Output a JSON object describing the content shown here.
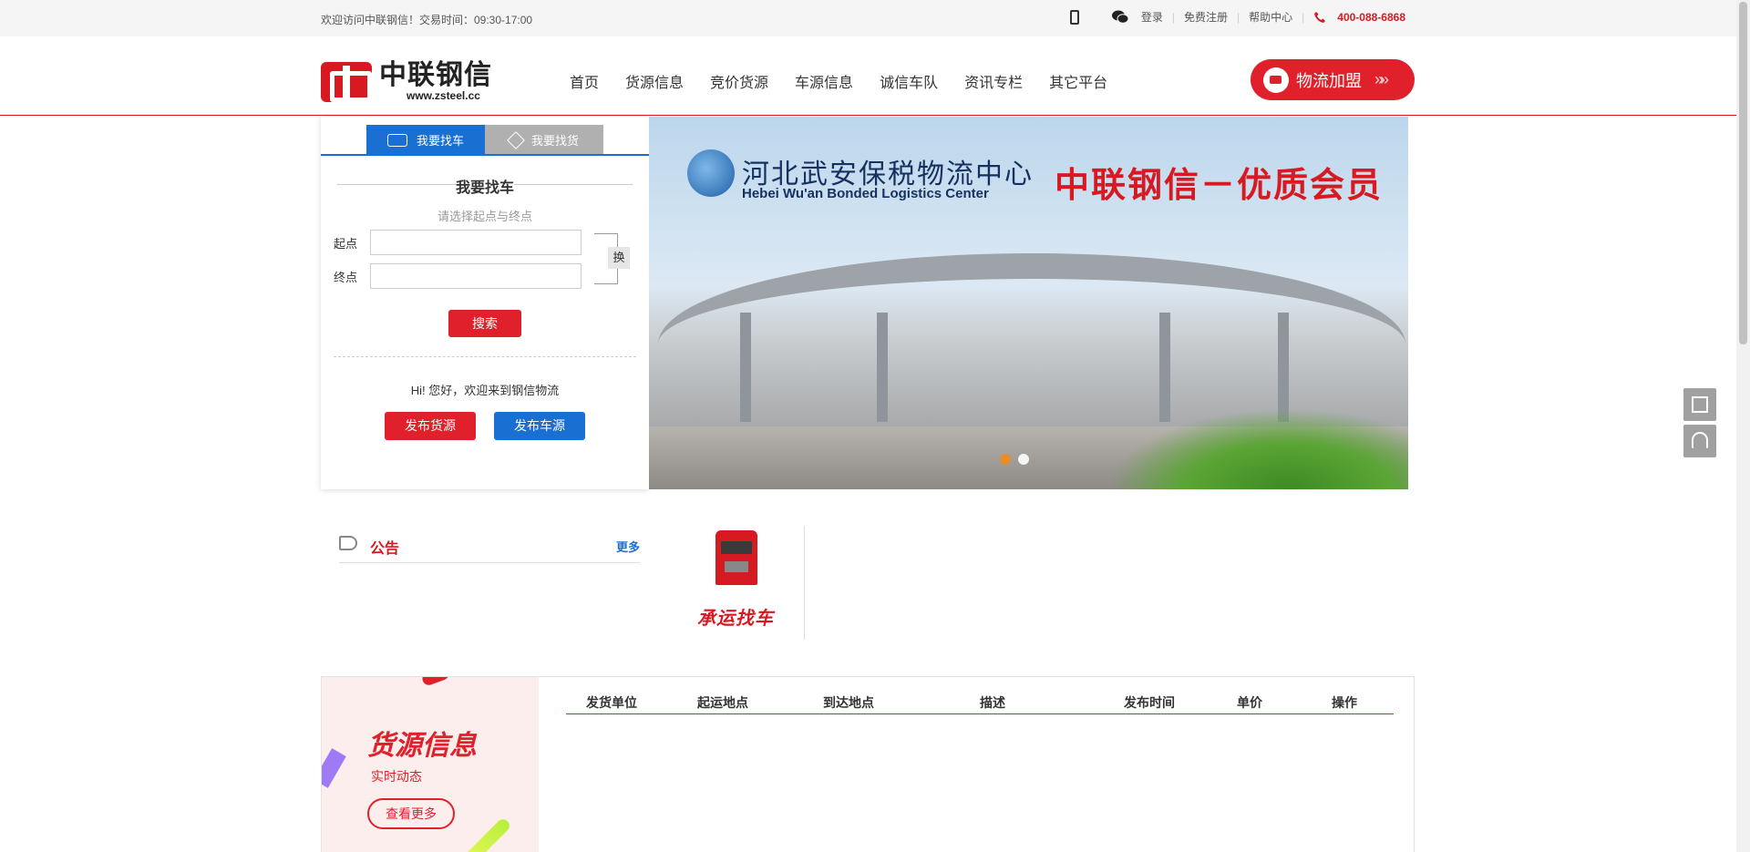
{
  "topbar": {
    "welcome": "欢迎访问中联钢信！交易时间：09:30-17:00",
    "login": "登录",
    "register": "免费注册",
    "help": "帮助中心",
    "tel": "400-088-6868"
  },
  "logo": {
    "cn": "中联钢信",
    "en": "www.zsteel.cc"
  },
  "nav": [
    "首页",
    "货源信息",
    "竞价货源",
    "车源信息",
    "诚信车队",
    "资讯专栏",
    "其它平台"
  ],
  "join": {
    "label": "物流加盟",
    "arrows": "»»"
  },
  "panel": {
    "tab_car": "我要找车",
    "tab_goods": "我要找货",
    "title": "我要找车",
    "subtitle": "请选择起点与终点",
    "start_label": "起点",
    "end_label": "终点",
    "swap": "换",
    "search": "搜索",
    "hi": "Hi! 您好，欢迎来到钢信物流",
    "publish_goods": "发布货源",
    "publish_car": "发布车源"
  },
  "banner": {
    "cn_name": "河北武安保税物流中心",
    "en_name": "Hebei Wu'an Bonded Logistics Center",
    "slogan": "中联钢信－优质会员"
  },
  "notice": {
    "title": "公告",
    "more": "更多"
  },
  "truck": {
    "label": "承运找车"
  },
  "cargo": {
    "title": "货源信息",
    "subtitle": "实时动态",
    "more": "查看更多",
    "columns": [
      "发货单位",
      "起运地点",
      "到达地点",
      "描述",
      "发布时间",
      "单价",
      "操作"
    ]
  },
  "colors": {
    "brand_red": "#d71a21",
    "brand_blue": "#1a6fd3"
  }
}
